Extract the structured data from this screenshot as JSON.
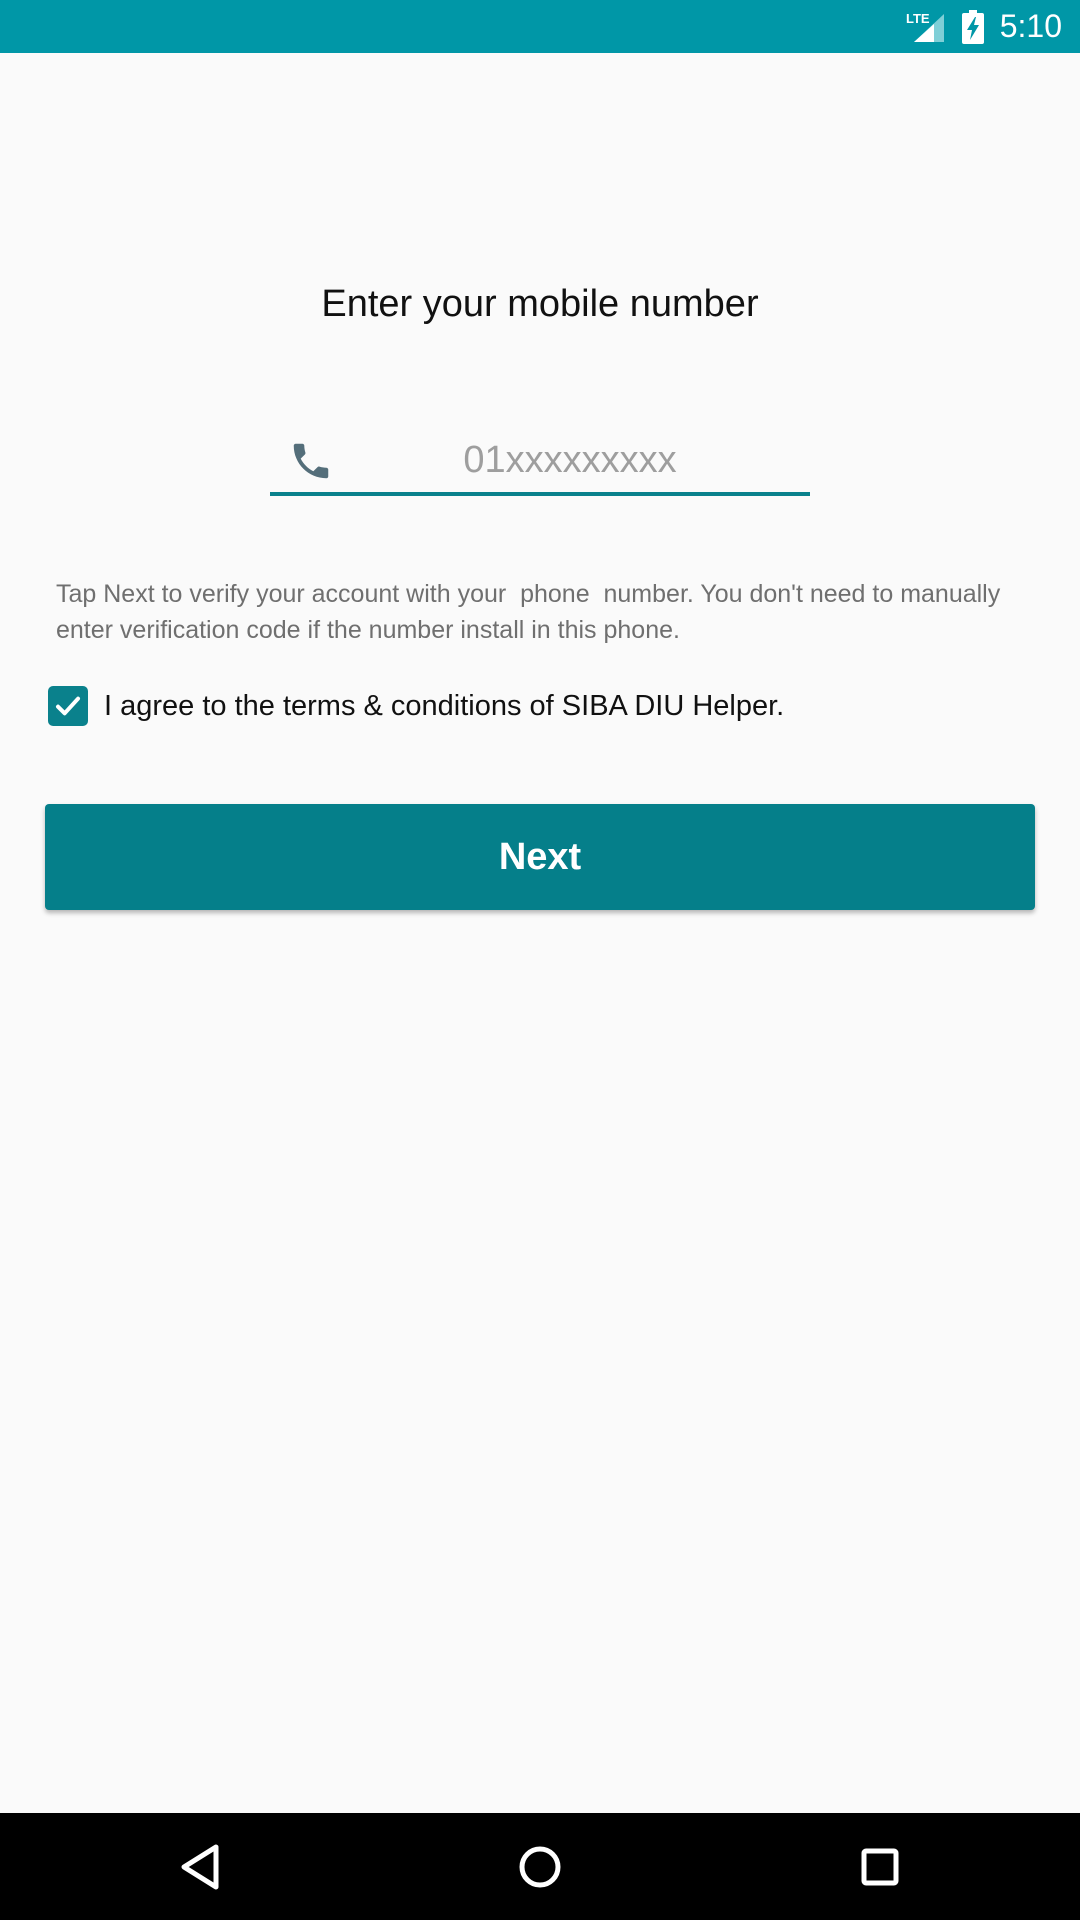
{
  "status_bar": {
    "network_label": "LTE",
    "time": "5:10",
    "icons": [
      "lte-signal-icon",
      "battery-charging-icon"
    ],
    "background_color": "#0097a7"
  },
  "form": {
    "title": "Enter your mobile number",
    "phone_placeholder": "01xxxxxxxxx",
    "phone_value": "",
    "phone_icon": "phone-icon",
    "info_text": "Tap Next to verify your account with your  phone  number. You don't need to manually enter verification code if the number install in this phone.",
    "terms_checked": true,
    "terms_label": "I agree to the terms & conditions of SIBA DIU Helper.",
    "next_label": "Next",
    "accent_color": "#0a818c"
  },
  "nav_bar": {
    "icons": [
      "back-icon",
      "home-icon",
      "recents-icon"
    ]
  }
}
